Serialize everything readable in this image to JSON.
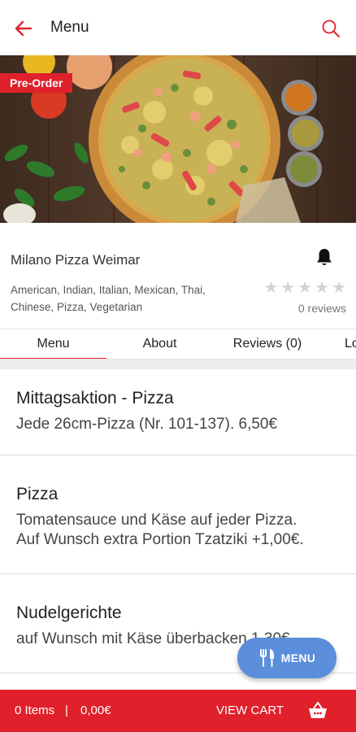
{
  "header": {
    "title": "Menu",
    "back_icon": "arrow-left-icon",
    "search_icon": "search-icon",
    "accent_color": "#e0212b"
  },
  "hero": {
    "badge": "Pre-Order"
  },
  "restaurant": {
    "name": "Milano Pizza Weimar",
    "cuisines": "American, Indian, Italian, Mexican, Thai, Chinese, Pizza, Vegetarian",
    "rating": 0,
    "reviews_text": "0 reviews"
  },
  "tabs": [
    {
      "label": "Menu",
      "active": true
    },
    {
      "label": "About",
      "active": false
    },
    {
      "label": "Reviews (0)",
      "active": false
    },
    {
      "label": "Lo",
      "active": false
    }
  ],
  "categories": [
    {
      "title": "Mittagsaktion - Pizza",
      "description": "Jede 26cm-Pizza (Nr. 101-137). 6,50€"
    },
    {
      "title": "Pizza",
      "description": "Tomatensauce und Käse auf jeder Pizza.\nAuf Wunsch extra Portion Tzatziki +1,00€."
    },
    {
      "title": "Nudelgerichte",
      "description": "auf Wunsch mit Käse überbacken 1,30€"
    }
  ],
  "fab": {
    "label": "MENU",
    "icon": "fork-knife-icon",
    "color": "#5b8edb"
  },
  "cart": {
    "items": "0 Items",
    "separator": "|",
    "total": "0,00€",
    "view_label": "VIEW CART",
    "icon": "basket-icon"
  }
}
